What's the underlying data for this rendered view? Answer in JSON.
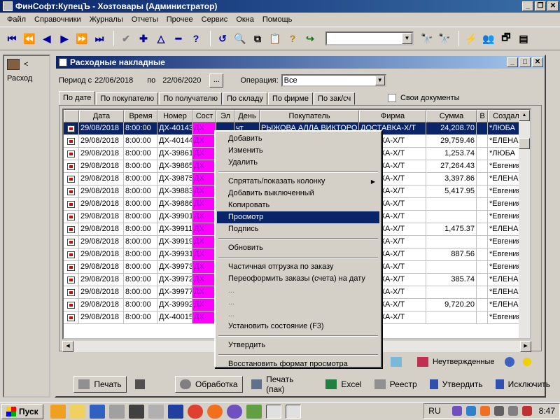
{
  "app": {
    "title": "ФинСофт:КупецЪ - Хозтовары  (Администратор)"
  },
  "menu": [
    "Файл",
    "Справочники",
    "Журналы",
    "Отчеты",
    "Прочее",
    "Сервис",
    "Окна",
    "Помощь"
  ],
  "left_panel": {
    "label": "Расход",
    "arrow": "<"
  },
  "window": {
    "title": "Расходные накладные"
  },
  "period": {
    "label_from": "Период с",
    "from": "22/06/2018",
    "label_to": "по",
    "to": "22/06/2020",
    "dots": "...",
    "op_label": "Операция:",
    "op_value": "Все"
  },
  "tabs": [
    "По дате",
    "По покупателю",
    "По получателю",
    "По складу",
    "По фирме",
    "По зак/сч"
  ],
  "own_docs": "Свои документы",
  "columns": [
    "Дата",
    "Время",
    "Номер",
    "Сост",
    "Эл",
    "День",
    "Покупатель",
    "Фирма",
    "Сумма",
    "В",
    "Создал"
  ],
  "rows": [
    {
      "date": "29/08/2018",
      "time": "8:00:00",
      "num": "ДХ-40143",
      "sost": "ДХ",
      "day": "чт",
      "buyer": "РЫЖОВА АЛЛА ВИКТОРО",
      "firm": "ДОСТАВКА-Х/Т",
      "sum": "24,208.70",
      "creator": "*ЛЮБА"
    },
    {
      "date": "29/08/2018",
      "time": "8:00:00",
      "num": "ДХ-40144",
      "sost": "ДХ",
      "day": "",
      "buyer": "",
      "firm": "СТАВКА-Х/Т",
      "sum": "29,759.46",
      "creator": "*ЕЛЕНА"
    },
    {
      "date": "29/08/2018",
      "time": "8:00:00",
      "num": "ДХ-39861",
      "sost": "ДХ",
      "day": "",
      "buyer": "",
      "firm": "СТАВКА-Х/Т",
      "sum": "1,253.74",
      "creator": "*ЛЮБА"
    },
    {
      "date": "29/08/2018",
      "time": "8:00:00",
      "num": "ДХ-39865",
      "sost": "ДХ",
      "day": "",
      "buyer": "",
      "firm": "СТАВКА-Х/Т",
      "sum": "27,264.43",
      "creator": "*Евгения"
    },
    {
      "date": "29/08/2018",
      "time": "8:00:00",
      "num": "ДХ-39875",
      "sost": "ДХ",
      "day": "",
      "buyer": "",
      "firm": "СТАВКА-Х/Т",
      "sum": "3,397.86",
      "creator": "*ЕЛЕНА"
    },
    {
      "date": "29/08/2018",
      "time": "8:00:00",
      "num": "ДХ-39883",
      "sost": "ДХ",
      "day": "",
      "buyer": "",
      "firm": "СТАВКА-Х/Т",
      "sum": "5,417.95",
      "creator": "*Евгения"
    },
    {
      "date": "29/08/2018",
      "time": "8:00:00",
      "num": "ДХ-39886",
      "sost": "ДХ",
      "day": "",
      "buyer": "",
      "firm": "СТАВКА-Х/Т",
      "sum": "",
      "creator": "*Евгения"
    },
    {
      "date": "29/08/2018",
      "time": "8:00:00",
      "num": "ДХ-39901",
      "sost": "ДХ",
      "day": "",
      "buyer": "",
      "firm": "СТАВКА-Х/Т",
      "sum": "",
      "creator": "*Евгения"
    },
    {
      "date": "29/08/2018",
      "time": "8:00:00",
      "num": "ДХ-39911",
      "sost": "ДХ",
      "day": "",
      "buyer": "",
      "firm": "СТАВКА-Х/Т",
      "sum": "1,475.37",
      "creator": "*ЕЛЕНА"
    },
    {
      "date": "29/08/2018",
      "time": "8:00:00",
      "num": "ДХ-39919",
      "sost": "ДХ",
      "day": "",
      "buyer": "",
      "firm": "СТАВКА-Х/Т",
      "sum": "",
      "creator": "*Евгения"
    },
    {
      "date": "29/08/2018",
      "time": "8:00:00",
      "num": "ДХ-39931",
      "sost": "ДХ",
      "day": "",
      "buyer": "",
      "firm": "СТАВКА-Х/Т",
      "sum": "887.56",
      "creator": "*Евгения"
    },
    {
      "date": "29/08/2018",
      "time": "8:00:00",
      "num": "ДХ-39973",
      "sost": "ДХ",
      "day": "",
      "buyer": "",
      "firm": "СТАВКА-Х/Т",
      "sum": "",
      "creator": "*Евгения"
    },
    {
      "date": "29/08/2018",
      "time": "8:00:00",
      "num": "ДХ-39972",
      "sost": "ДХ",
      "day": "",
      "buyer": "",
      "firm": "СТАВКА-Х/Т",
      "sum": "385.74",
      "creator": "*ЕЛЕНА"
    },
    {
      "date": "29/08/2018",
      "time": "8:00:00",
      "num": "ДХ-39977",
      "sost": "ДХ",
      "day": "",
      "buyer": "",
      "firm": "СТАВКА-Х/Т",
      "sum": "",
      "creator": "*ЕЛЕНА"
    },
    {
      "date": "29/08/2018",
      "time": "8:00:00",
      "num": "ДХ-39992",
      "sost": "ДХ",
      "day": "",
      "buyer": "",
      "firm": "СТАВКА-Х/Т",
      "sum": "9,720.20",
      "creator": "*ЕЛЕНА"
    },
    {
      "date": "29/08/2018",
      "time": "8:00:00",
      "num": "ДХ-40015",
      "sost": "ДХ",
      "day": "",
      "buyer": "",
      "firm": "СТАВКА-Х/Т",
      "sum": "",
      "creator": "*Евгения"
    }
  ],
  "context_menu": {
    "items": [
      "Добавить",
      "Изменить",
      "Удалить",
      "Спрятать/показать колонку",
      "Добавить выключенный",
      "Копировать",
      "Просмотр",
      "Подпись",
      "Обновить",
      "Частичная отгрузка по заказу",
      "Переоформить заказы (счета) на дату",
      "...",
      "...",
      "...",
      "Установить состояние (F3)",
      "Утвердить",
      "Восстановить формат просмотра"
    ],
    "highlighted": "Просмотр"
  },
  "status": {
    "unapproved": "Неутвержденные"
  },
  "bottom": {
    "print": "Печать",
    "process": "Обработка",
    "print_pack": "Печать (пак)",
    "excel": "Excel",
    "registry": "Реестр",
    "approve": "Утвердить",
    "exclude": "Исключить"
  },
  "taskbar": {
    "start": "Пуск",
    "lang": "RU",
    "clock": "8:47"
  },
  "colors": {
    "title_bar": "#0a246a",
    "selection": "#0a246a",
    "status_magenta": "#ff00ff"
  }
}
